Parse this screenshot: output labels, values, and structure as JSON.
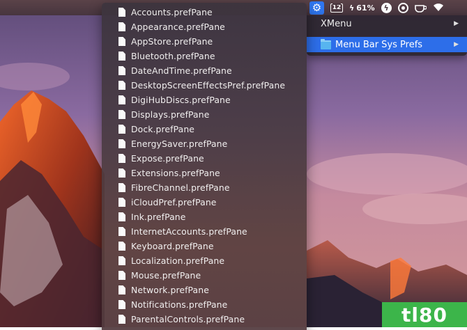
{
  "menubar": {
    "calendar_day": "12",
    "battery_percent": "61%",
    "status_icons": [
      "gear-icon",
      "calendar-icon",
      "battery-charging-icon",
      "bolt-circle-icon",
      "record-icon",
      "coffee-cup-icon",
      "wifi-icon"
    ]
  },
  "xmenu": {
    "items": [
      {
        "label": "XMenu"
      },
      {
        "label": "Menu Bar Sys Prefs"
      }
    ],
    "highlight_color": "#2d6ee9"
  },
  "submenu": {
    "items": [
      {
        "label": "Accounts.prefPane"
      },
      {
        "label": "Appearance.prefPane"
      },
      {
        "label": "AppStore.prefPane"
      },
      {
        "label": "Bluetooth.prefPane"
      },
      {
        "label": "DateAndTime.prefPane"
      },
      {
        "label": "DesktopScreenEffectsPref.prefPane"
      },
      {
        "label": "DigiHubDiscs.prefPane"
      },
      {
        "label": "Displays.prefPane"
      },
      {
        "label": "Dock.prefPane"
      },
      {
        "label": "EnergySaver.prefPane"
      },
      {
        "label": "Expose.prefPane"
      },
      {
        "label": "Extensions.prefPane"
      },
      {
        "label": "FibreChannel.prefPane"
      },
      {
        "label": "iCloudPref.prefPane"
      },
      {
        "label": "Ink.prefPane"
      },
      {
        "label": "InternetAccounts.prefPane"
      },
      {
        "label": "Keyboard.prefPane"
      },
      {
        "label": "Localization.prefPane"
      },
      {
        "label": "Mouse.prefPane"
      },
      {
        "label": "Network.prefPane"
      },
      {
        "label": "Notifications.prefPane"
      },
      {
        "label": "ParentalControls.prefPane"
      }
    ]
  },
  "watermark": {
    "text": "tl80",
    "color": "#3cb54a"
  }
}
